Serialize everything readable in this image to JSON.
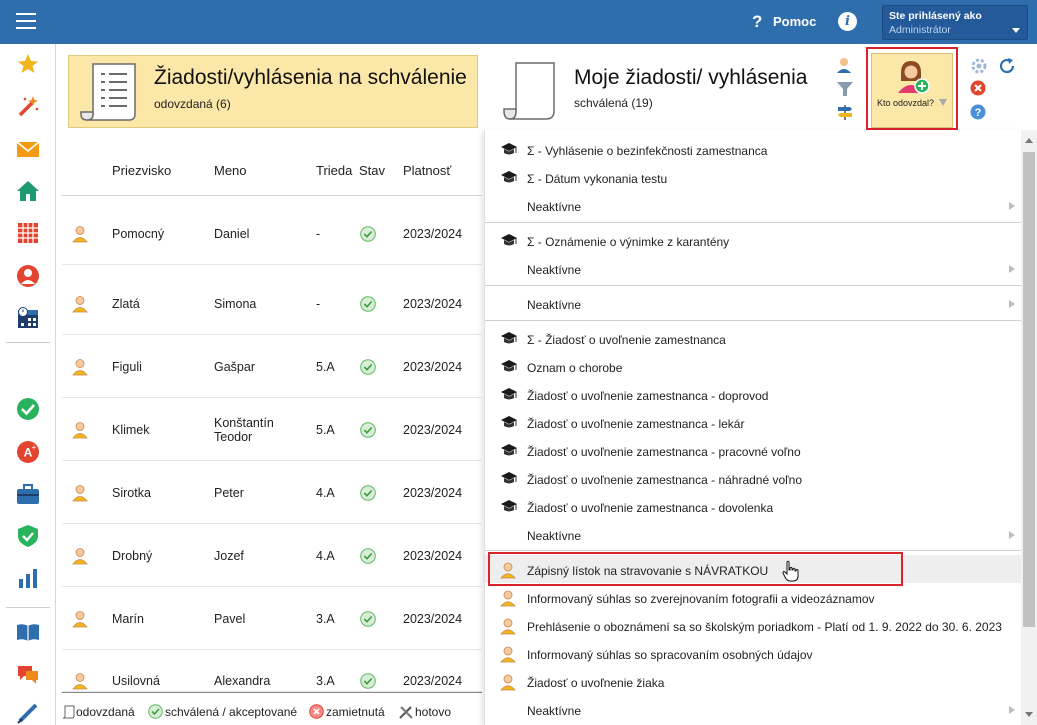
{
  "topbar": {
    "help_label": "Pomoc",
    "help_symbol": "?",
    "info_symbol": "i",
    "user_line1": "Ste prihlásený ako",
    "user_line2": "Administrátor"
  },
  "sidebar": {
    "items": [
      "star-icon",
      "magic-wand-icon",
      "mail-icon",
      "home-icon",
      "timetable-icon",
      "person-circle-icon",
      "calendar-clock-icon",
      "check-circle-icon",
      "grade-icon",
      "briefcase-icon",
      "shield-icon",
      "bar-chart-icon",
      "book-icon",
      "chat-icon",
      "pen-icon"
    ]
  },
  "header": {
    "left_title": "Žiadosti/vyhlásenia na schválenie",
    "left_subtitle": "odovzdaná (6)",
    "right_title": "Moje žiadosti/ vyhlásenia",
    "right_subtitle": "schválená (19)",
    "who_button_label": "Kto odovzdal?"
  },
  "table": {
    "columns": [
      "Priezvisko",
      "Meno",
      "Trieda",
      "Stav",
      "Platnosť"
    ],
    "rows": [
      {
        "surname": "Pomocný",
        "name": "Daniel",
        "class": "-",
        "validity": "2023/2024"
      },
      {
        "surname": "Zlatá",
        "name": "Simona",
        "class": "-",
        "validity": "2023/2024"
      },
      {
        "surname": "Figuli",
        "name": "Gašpar",
        "class": "5.A",
        "validity": "2023/2024"
      },
      {
        "surname": "Klimek",
        "name": "Konštantín",
        "name2": "Teodor",
        "class": "5.A",
        "validity": "2023/2024"
      },
      {
        "surname": "Sirotka",
        "name": "Peter",
        "class": "4.A",
        "validity": "2023/2024"
      },
      {
        "surname": "Drobný",
        "name": "Jozef",
        "class": "4.A",
        "validity": "2023/2024"
      },
      {
        "surname": "Marín",
        "name": "Pavel",
        "class": "3.A",
        "validity": "2023/2024"
      },
      {
        "surname": "Usilovná",
        "name": "Alexandra",
        "class": "3.A",
        "validity": "2023/2024"
      }
    ]
  },
  "legend": {
    "submitted": "odovzdaná",
    "approved": "schválená / akceptované",
    "rejected": "zamietnutá",
    "done": "hotovo"
  },
  "menu": {
    "items": [
      "Σ - Vyhlásenie o bezinfekčnosti zamestnanca",
      "Σ - Dátum vykonania testu",
      "Neaktívne",
      "Σ - Oznámenie o výnimke z karantény",
      "Neaktívne",
      "Neaktívne",
      "Σ - Žiadosť o uvoľnenie zamestnanca",
      "Oznam o chorobe",
      "Žiadosť o uvoľnenie zamestnanca - doprovod",
      "Žiadosť o uvoľnenie zamestnanca - lekár",
      "Žiadosť o uvoľnenie zamestnanca - pracovné voľno",
      "Žiadosť o uvoľnenie zamestnanca - náhradné voľno",
      "Žiadosť o uvoľnenie zamestnanca - dovolenka",
      "Neaktívne",
      "Zápisný lístok na stravovanie s NÁVRATKOU",
      "Informovaný súhlas so zverejnovaním fotografii a videozáznamov",
      "Prehlásenie o oboznámení sa so školským poriadkom - Platí od 1. 9. 2022 do 30. 6. 2023",
      "Informovaný súhlas so spracovaním osobných údajov",
      "Žiadosť o uvoľnenie žiaka",
      "Neaktívne"
    ]
  },
  "colors": {
    "topbar": "#2f6ead",
    "card_yellow": "#fbe8a8",
    "highlight_red": "#d9232a",
    "approved_green": "#5cb85c"
  }
}
